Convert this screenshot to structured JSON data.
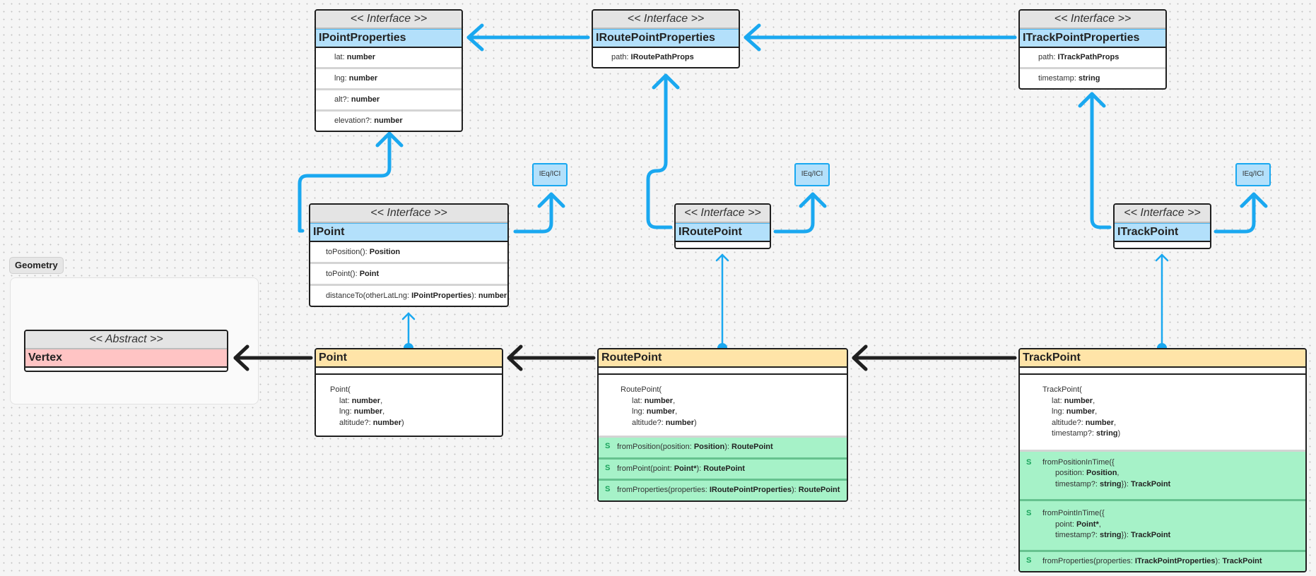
{
  "group": {
    "label": "Geometry"
  },
  "colors": {
    "interface_header": "#b3e0fb",
    "class_header": "#ffe4a8",
    "abstract_header": "#ffc4c4",
    "static_method_bg": "#a6f2c8",
    "connector_blue": "#1aa8f0",
    "connector_black": "#1f1f1f"
  },
  "interfaces": {
    "IPointProperties": {
      "stereotype": "<< Interface >>",
      "name": "IPointProperties",
      "fields": [
        {
          "name": "lat: ",
          "type": "number"
        },
        {
          "name": "lng: ",
          "type": "number"
        },
        {
          "name": "alt?: ",
          "type": "number"
        },
        {
          "name": "elevation?: ",
          "type": "number"
        }
      ]
    },
    "IRoutePointProperties": {
      "stereotype": "<< Interface >>",
      "name": "IRoutePointProperties",
      "fields": [
        {
          "name": "path: ",
          "type": "IRoutePathProps"
        }
      ]
    },
    "ITrackPointProperties": {
      "stereotype": "<< Interface >>",
      "name": "ITrackPointProperties",
      "fields": [
        {
          "name": "path: ",
          "type": "ITrackPathProps"
        },
        {
          "name": "timestamp: ",
          "type": "string"
        }
      ]
    },
    "IPoint": {
      "stereotype": "<< Interface >>",
      "name": "IPoint",
      "methods": [
        {
          "sig": "toPosition(): ",
          "ret": "Position"
        },
        {
          "sig": "toPoint(): ",
          "ret": "Point"
        },
        {
          "sig": "distanceTo(otherLatLng: ",
          "param_type": "IPointProperties",
          "tail": "): ",
          "ret": "number"
        }
      ]
    },
    "IRoutePoint": {
      "stereotype": "<< Interface >>",
      "name": "IRoutePoint"
    },
    "ITrackPoint": {
      "stereotype": "<< Interface >>",
      "name": "ITrackPoint"
    }
  },
  "ieq_boxes": [
    {
      "label": "IEq/ICI"
    },
    {
      "label": "IEq/ICI"
    },
    {
      "label": "IEq/ICI"
    }
  ],
  "abstract": {
    "stereotype": "<< Abstract >>",
    "name": "Vertex"
  },
  "classes": {
    "Point": {
      "name": "Point",
      "ctor": {
        "open": "Point(",
        "params": [
          {
            "name": "lat: ",
            "type": "number",
            "sep": ","
          },
          {
            "name": "lng: ",
            "type": "number",
            "sep": ","
          },
          {
            "name": "altitude?: ",
            "type": "number",
            "sep": ")"
          }
        ]
      }
    },
    "RoutePoint": {
      "name": "RoutePoint",
      "ctor": {
        "open": "RoutePoint(",
        "params": [
          {
            "name": "lat: ",
            "type": "number",
            "sep": ","
          },
          {
            "name": "lng: ",
            "type": "number",
            "sep": ","
          },
          {
            "name": "altitude?: ",
            "type": "number",
            "sep": ")"
          }
        ]
      },
      "static_marker": "S",
      "static_methods": [
        {
          "pre": "fromPosition(position: ",
          "ptype": "Position",
          "mid": "): ",
          "ret": "RoutePoint"
        },
        {
          "pre": "fromPoint(point: ",
          "ptype": "Point*",
          "mid": "): ",
          "ret": "RoutePoint"
        },
        {
          "pre": "fromProperties(properties: ",
          "ptype": "IRoutePointProperties",
          "mid": "): ",
          "ret": "RoutePoint"
        }
      ]
    },
    "TrackPoint": {
      "name": "TrackPoint",
      "ctor": {
        "open": "TrackPoint(",
        "params": [
          {
            "name": "lat: ",
            "type": "number",
            "sep": ","
          },
          {
            "name": "lng: ",
            "type": "number",
            "sep": ","
          },
          {
            "name": "altitude?: ",
            "type": "number",
            "sep": ","
          },
          {
            "name": "timestamp?: ",
            "type": "string",
            "sep": ")"
          }
        ]
      },
      "static_marker": "S",
      "static_methods": [
        {
          "open": "fromPositionInTime({",
          "l1_name": "position: ",
          "l1_type": "Position",
          "l1_sep": ",",
          "l2_name": "timestamp?: ",
          "l2_type": "string",
          "l2_mid": "}): ",
          "ret": "TrackPoint"
        },
        {
          "open": "fromPointInTime({",
          "l1_name": "point: ",
          "l1_type": "Point*",
          "l1_sep": ",",
          "l2_name": "timestamp?: ",
          "l2_type": "string",
          "l2_mid": "}): ",
          "ret": "TrackPoint"
        },
        {
          "pre": "fromProperties(properties: ",
          "ptype": "ITrackPointProperties",
          "mid": "): ",
          "ret": "TrackPoint"
        }
      ]
    }
  }
}
